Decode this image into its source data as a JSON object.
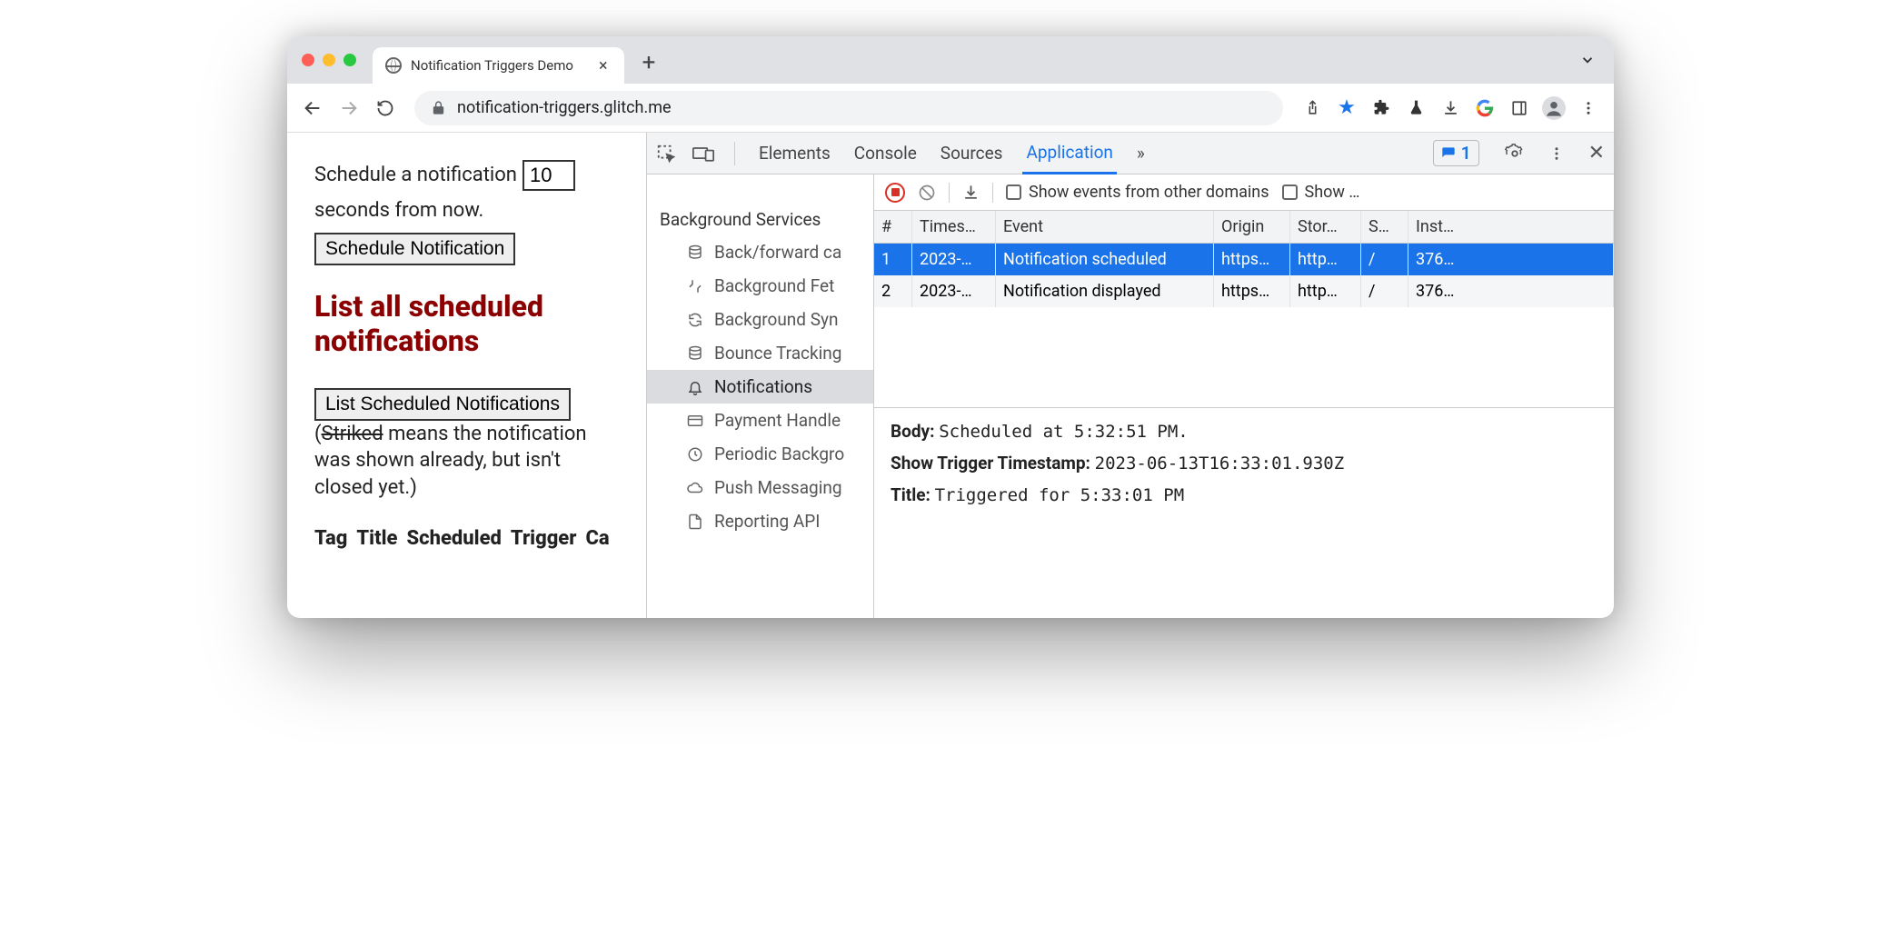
{
  "tab": {
    "title": "Notification Triggers Demo"
  },
  "url": {
    "host": "notification-triggers.glitch.me"
  },
  "page": {
    "schedule_pre": "Schedule a notification",
    "seconds_value": "10",
    "schedule_post": "seconds from now.",
    "schedule_btn": "Schedule Notification",
    "heading": "List all scheduled notifications",
    "list_btn": "List Scheduled Notifications",
    "note_open": "(",
    "note_strike": "Striked",
    "note_rest": " means the notification was shown already, but isn't closed yet.)",
    "thead": [
      "Tag",
      "Title",
      "Scheduled",
      "Trigger",
      "Ca"
    ]
  },
  "devtools": {
    "tabs": [
      "Elements",
      "Console",
      "Sources",
      "Application"
    ],
    "active_tab": "Application",
    "more": "»",
    "badge_count": "1",
    "sidebar": {
      "header": "Background Services",
      "items": [
        "Back/forward ca",
        "Background Fet",
        "Background Syn",
        "Bounce Tracking",
        "Notifications",
        "Payment Handle",
        "Periodic Backgro",
        "Push Messaging",
        "Reporting API"
      ],
      "selected_index": 4
    },
    "toolbar": {
      "cb1": "Show events from other domains",
      "cb2": "Show …"
    },
    "table": {
      "headers": [
        "#",
        "Times…",
        "Event",
        "Origin",
        "Stor…",
        "S…",
        "Inst…"
      ],
      "rows": [
        {
          "n": "1",
          "ts": "2023-…",
          "ev": "Notification scheduled",
          "or": "https…",
          "st": "http…",
          "sw": "/",
          "in": "376…",
          "selected": true
        },
        {
          "n": "2",
          "ts": "2023-…",
          "ev": "Notification displayed",
          "or": "https…",
          "st": "http…",
          "sw": "/",
          "in": "376…",
          "selected": false
        }
      ]
    },
    "details": {
      "body_k": "Body:",
      "body_v": "Scheduled at 5:32:51 PM.",
      "trig_k": "Show Trigger Timestamp:",
      "trig_v": "2023-06-13T16:33:01.930Z",
      "title_k": "Title:",
      "title_v": "Triggered for 5:33:01 PM"
    }
  }
}
